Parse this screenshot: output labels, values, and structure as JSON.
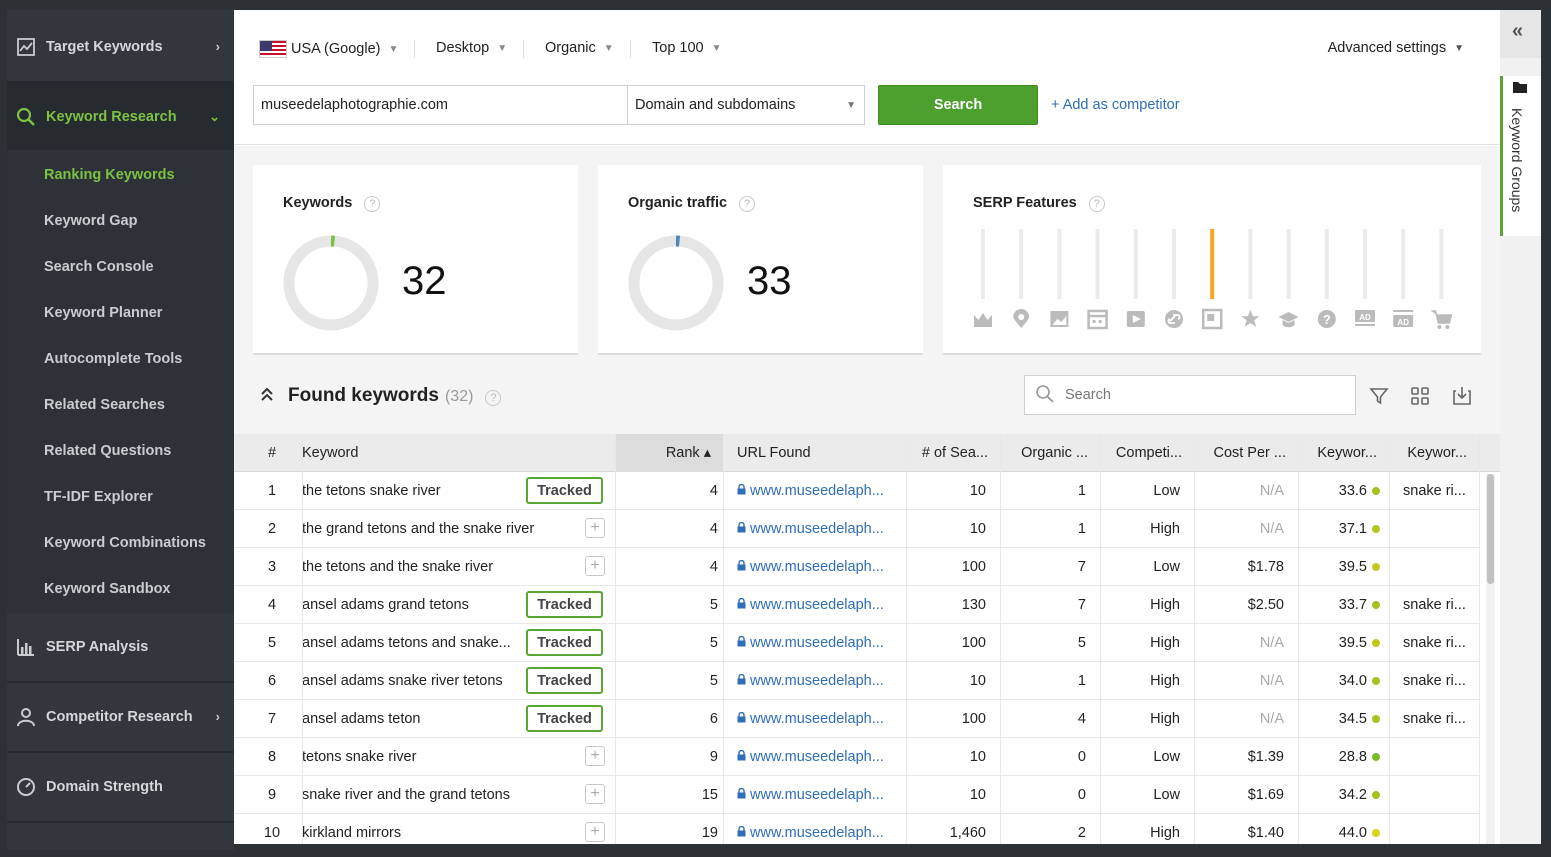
{
  "sidebar": {
    "target_keywords": "Target Keywords",
    "keyword_research": "Keyword Research",
    "sub": [
      "Ranking Keywords",
      "Keyword Gap",
      "Search Console",
      "Keyword Planner",
      "Autocomplete Tools",
      "Related Searches",
      "Related Questions",
      "TF-IDF Explorer",
      "Keyword Combinations",
      "Keyword Sandbox"
    ],
    "serp_analysis": "SERP Analysis",
    "competitor_research": "Competitor Research",
    "domain_strength": "Domain Strength"
  },
  "filters": {
    "country": "USA (Google)",
    "device": "Desktop",
    "result_type": "Organic",
    "depth": "Top 100",
    "advanced": "Advanced settings"
  },
  "search": {
    "domain_value": "museedelaphotographie.com",
    "scope": "Domain and subdomains",
    "button": "Search",
    "add_competitor": "+ Add as competitor"
  },
  "cards": {
    "keywords_label": "Keywords",
    "keywords_value": "32",
    "traffic_label": "Organic traffic",
    "traffic_value": "33",
    "serp_label": "SERP Features",
    "help": "?"
  },
  "serp_features": [
    "crown-icon",
    "map-pin-icon",
    "image-icon",
    "calendar-icon",
    "video-icon",
    "link-icon",
    "snippet-icon",
    "star-icon",
    "graduation-cap-icon",
    "question-icon",
    "ad-top-icon",
    "ad-bottom-icon",
    "cart-icon"
  ],
  "serp_highlight_index": 6,
  "found": {
    "title": "Found keywords",
    "count": "(32)",
    "search_placeholder": "Search"
  },
  "table": {
    "headers": {
      "num": "#",
      "keyword": "Keyword",
      "rank": "Rank ▴",
      "url": "URL Found",
      "searches": "# of Sea...",
      "organic": "Organic ...",
      "competition": "Competi...",
      "cpc": "Cost Per ...",
      "kd": "Keywor...",
      "kg": "Keywor..."
    },
    "tracked_label": "Tracked",
    "rows": [
      {
        "n": "1",
        "kw": "the tetons snake river",
        "tracked": true,
        "rank": "4",
        "url": "www.museedelaph...",
        "searches": "10",
        "organic": "1",
        "comp": "Low",
        "cpc": "N/A",
        "kd": "33.6",
        "kdc": "#a4c21e",
        "group": "snake ri..."
      },
      {
        "n": "2",
        "kw": "the grand tetons and the snake river",
        "tracked": false,
        "rank": "4",
        "url": "www.museedelaph...",
        "searches": "10",
        "organic": "1",
        "comp": "High",
        "cpc": "N/A",
        "kd": "37.1",
        "kdc": "#b5c51c",
        "group": ""
      },
      {
        "n": "3",
        "kw": "the tetons and the snake river",
        "tracked": false,
        "rank": "4",
        "url": "www.museedelaph...",
        "searches": "100",
        "organic": "7",
        "comp": "Low",
        "cpc": "$1.78",
        "kd": "39.5",
        "kdc": "#c2c81a",
        "group": ""
      },
      {
        "n": "4",
        "kw": "ansel adams grand tetons",
        "tracked": true,
        "rank": "5",
        "url": "www.museedelaph...",
        "searches": "130",
        "organic": "7",
        "comp": "High",
        "cpc": "$2.50",
        "kd": "33.7",
        "kdc": "#a4c21e",
        "group": "snake ri..."
      },
      {
        "n": "5",
        "kw": "ansel adams tetons and snake...",
        "tracked": true,
        "rank": "5",
        "url": "www.museedelaph...",
        "searches": "100",
        "organic": "5",
        "comp": "High",
        "cpc": "N/A",
        "kd": "39.5",
        "kdc": "#c2c81a",
        "group": "snake ri..."
      },
      {
        "n": "6",
        "kw": "ansel adams snake river tetons",
        "tracked": true,
        "rank": "5",
        "url": "www.museedelaph...",
        "searches": "10",
        "organic": "1",
        "comp": "High",
        "cpc": "N/A",
        "kd": "34.0",
        "kdc": "#a4c21e",
        "group": "snake ri..."
      },
      {
        "n": "7",
        "kw": "ansel adams teton",
        "tracked": true,
        "rank": "6",
        "url": "www.museedelaph...",
        "searches": "100",
        "organic": "4",
        "comp": "High",
        "cpc": "N/A",
        "kd": "34.5",
        "kdc": "#a8c31e",
        "group": "snake ri..."
      },
      {
        "n": "8",
        "kw": "tetons snake river",
        "tracked": false,
        "rank": "9",
        "url": "www.museedelaph...",
        "searches": "10",
        "organic": "0",
        "comp": "Low",
        "cpc": "$1.39",
        "kd": "28.8",
        "kdc": "#7db828",
        "group": ""
      },
      {
        "n": "9",
        "kw": "snake river and the grand tetons",
        "tracked": false,
        "rank": "15",
        "url": "www.museedelaph...",
        "searches": "10",
        "organic": "0",
        "comp": "Low",
        "cpc": "$1.69",
        "kd": "34.2",
        "kdc": "#a4c21e",
        "group": ""
      },
      {
        "n": "10",
        "kw": "kirkland mirrors",
        "tracked": false,
        "rank": "19",
        "url": "www.museedelaph...",
        "searches": "1,460",
        "organic": "2",
        "comp": "High",
        "cpc": "$1.40",
        "kd": "44.0",
        "kdc": "#d8d21a",
        "group": ""
      }
    ]
  },
  "rail": {
    "label": "Keyword Groups",
    "collapse": "«"
  },
  "colors": {
    "accent": "#7cc242",
    "button": "#4d9f2e",
    "link": "#2f6fb6",
    "serp_highlight": "#f5a623"
  }
}
